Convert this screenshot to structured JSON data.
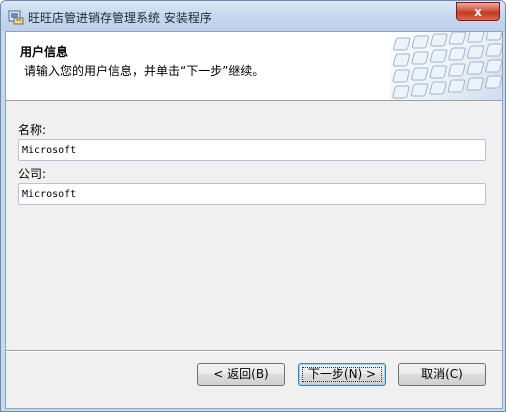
{
  "window": {
    "title": "旺旺店管进销存管理系统 安装程序",
    "close_label": "x"
  },
  "header": {
    "title": "用户信息",
    "subtitle": "请输入您的用户信息，并单击“下一步”继续。"
  },
  "form": {
    "name_label": "名称:",
    "name_value": "Microsoft",
    "company_label": "公司:",
    "company_value": "Microsoft"
  },
  "buttons": {
    "back": "< 返回(B)",
    "next": "下一步(N) >",
    "cancel": "取消(C)"
  }
}
